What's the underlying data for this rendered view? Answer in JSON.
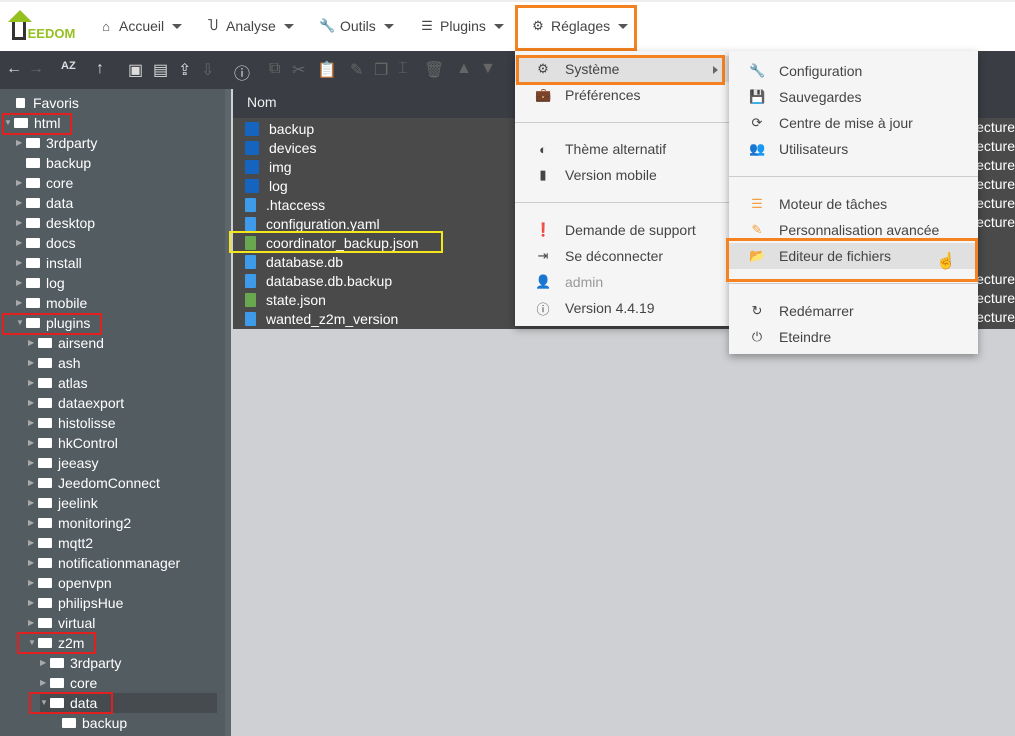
{
  "nav": {
    "logo": "JEEDOM",
    "items": [
      {
        "label": "Accueil",
        "icon": "home-icon"
      },
      {
        "label": "Analyse",
        "icon": "stethoscope-icon"
      },
      {
        "label": "Outils",
        "icon": "wrench-icon"
      },
      {
        "label": "Plugins",
        "icon": "tasks-icon"
      },
      {
        "label": "Réglages",
        "icon": "cog-icon"
      }
    ]
  },
  "tree": {
    "items": [
      {
        "label": "Favoris",
        "level": 0
      },
      {
        "label": "html",
        "level": 0,
        "open": true
      },
      {
        "label": "3rdparty",
        "level": 1
      },
      {
        "label": "backup",
        "level": 1
      },
      {
        "label": "core",
        "level": 1
      },
      {
        "label": "data",
        "level": 1
      },
      {
        "label": "desktop",
        "level": 1
      },
      {
        "label": "docs",
        "level": 1
      },
      {
        "label": "install",
        "level": 1
      },
      {
        "label": "log",
        "level": 1
      },
      {
        "label": "mobile",
        "level": 1
      },
      {
        "label": "plugins",
        "level": 1,
        "open": true
      },
      {
        "label": "airsend",
        "level": 2
      },
      {
        "label": "ash",
        "level": 2
      },
      {
        "label": "atlas",
        "level": 2
      },
      {
        "label": "dataexport",
        "level": 2
      },
      {
        "label": "histolisse",
        "level": 2
      },
      {
        "label": "hkControl",
        "level": 2
      },
      {
        "label": "jeeasy",
        "level": 2
      },
      {
        "label": "JeedomConnect",
        "level": 2
      },
      {
        "label": "jeelink",
        "level": 2
      },
      {
        "label": "monitoring2",
        "level": 2
      },
      {
        "label": "mqtt2",
        "level": 2
      },
      {
        "label": "notificationmanager",
        "level": 2
      },
      {
        "label": "openvpn",
        "level": 2
      },
      {
        "label": "philipsHue",
        "level": 2
      },
      {
        "label": "virtual",
        "level": 2
      },
      {
        "label": "z2m",
        "level": 2,
        "open": true
      },
      {
        "label": "3rdparty",
        "level": 3
      },
      {
        "label": "core",
        "level": 3
      },
      {
        "label": "data",
        "level": 3,
        "open": true
      },
      {
        "label": "backup",
        "level": 4
      }
    ]
  },
  "files": {
    "header": "Nom",
    "rows": [
      {
        "name": "backup",
        "type": "dir"
      },
      {
        "name": "devices",
        "type": "dir"
      },
      {
        "name": "img",
        "type": "dir"
      },
      {
        "name": "log",
        "type": "dir"
      },
      {
        "name": ".htaccess",
        "type": "doc"
      },
      {
        "name": "configuration.yaml",
        "type": "doc"
      },
      {
        "name": "coordinator_backup.json",
        "type": "json"
      },
      {
        "name": "database.db",
        "type": "doc"
      },
      {
        "name": "database.db.backup",
        "type": "doc"
      },
      {
        "name": "state.json",
        "type": "json"
      },
      {
        "name": "wanted_z2m_version",
        "type": "doc"
      }
    ],
    "perm_fragment": "ecture"
  },
  "reglages_menu": {
    "items": [
      "Système",
      "Préférences",
      "Thème alternatif",
      "Version mobile",
      "Demande de support",
      "Se déconnecter",
      "admin",
      "Version 4.4.19"
    ]
  },
  "systeme_menu": {
    "items": [
      "Configuration",
      "Sauvegardes",
      "Centre de mise à jour",
      "Utilisateurs",
      "Moteur de tâches",
      "Personnalisation avancée",
      "Editeur de fichiers",
      "Redémarrer",
      "Eteindre"
    ]
  },
  "colors": {
    "highlight": "#f58220",
    "red": "#e02020",
    "yellow": "#f5e61c"
  }
}
